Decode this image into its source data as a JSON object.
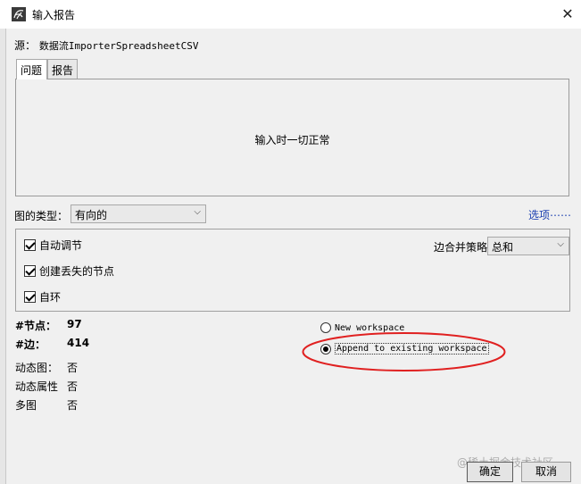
{
  "window": {
    "title": "输入报告",
    "close_glyph": "✕"
  },
  "source": {
    "label": "源：",
    "value": "数据流ImporterSpreadsheetCSV"
  },
  "tabs": [
    {
      "label": "问题",
      "active": true
    },
    {
      "label": "报告",
      "active": false
    }
  ],
  "report": {
    "message": "输入时一切正常"
  },
  "graph_type": {
    "label": "图的类型：",
    "selected": "有向的",
    "options_link": "选项⋯⋯"
  },
  "checkboxes": [
    {
      "label": "自动调节",
      "checked": true
    },
    {
      "label": "创建丢失的节点",
      "checked": true
    },
    {
      "label": "自环",
      "checked": true
    }
  ],
  "merge": {
    "label": "边合并策略",
    "selected": "总和"
  },
  "stats": {
    "nodes_label": "#节点：",
    "nodes_value": "97",
    "edges_label": "#边：",
    "edges_value": "414",
    "dynamic_graph_label": "动态图：",
    "dynamic_graph_value": "否",
    "dynamic_attr_label": "动态属性",
    "dynamic_attr_value": "否",
    "multigraph_label": "多图",
    "multigraph_value": "否"
  },
  "workspace": {
    "new_label": "New workspace",
    "new_selected": false,
    "append_label": "Append to existing workspace",
    "append_selected": true
  },
  "buttons": {
    "ok": "确定",
    "cancel": "取消"
  },
  "watermark": "@稀土掘金技术社区",
  "colors": {
    "annotation_red": "#e02020",
    "link_blue": "#1a3fb0"
  }
}
